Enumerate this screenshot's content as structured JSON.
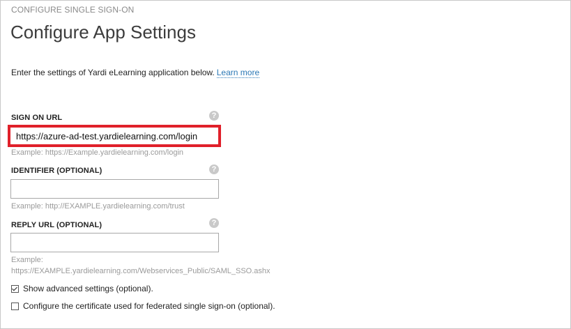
{
  "header": {
    "breadcrumb": "CONFIGURE SINGLE SIGN-ON",
    "title": "Configure App Settings"
  },
  "intro": {
    "text": "Enter the settings of Yardi eLearning application below.",
    "link": "Learn more"
  },
  "fields": {
    "sign_on": {
      "label": "SIGN ON URL",
      "value": "https://azure-ad-test.yardielearning.com/login",
      "example": "Example: https://Example.yardielearning.com/login"
    },
    "identifier": {
      "label": "IDENTIFIER (OPTIONAL)",
      "value": "",
      "example": "Example: http://EXAMPLE.yardielearning.com/trust"
    },
    "reply_url": {
      "label": "REPLY URL (OPTIONAL)",
      "value": "",
      "example_line1": "Example:",
      "example_line2": "https://EXAMPLE.yardielearning.com/Webservices_Public/SAML_SSO.ashx"
    }
  },
  "help_glyph": "?",
  "options": {
    "advanced": {
      "label": "Show advanced settings (optional).",
      "checked": true
    },
    "certificate": {
      "label": "Configure the certificate used for federated single sign-on (optional).",
      "checked": false
    }
  },
  "colors": {
    "highlight": "#e0202a",
    "link": "#2a77b5"
  }
}
